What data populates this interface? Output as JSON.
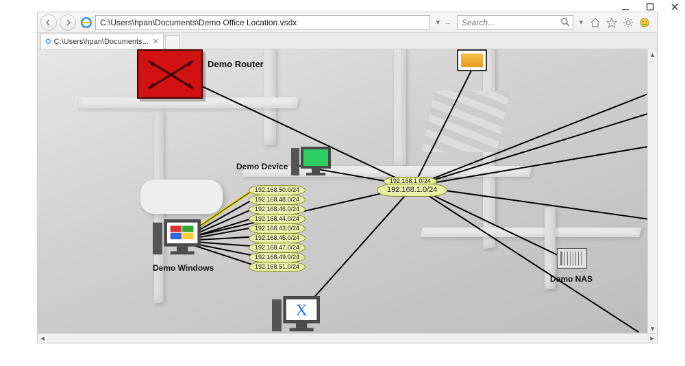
{
  "window": {
    "minimize": "–",
    "maximize": "☐",
    "close": "✕"
  },
  "browser": {
    "address_value": "C:\\Users\\hpan\\Documents\\Demo Office Location.vsdx",
    "search_placeholder": "Search...",
    "tab_title": "C:\\Users\\hpan\\Documents..."
  },
  "diagram": {
    "router_label": "Demo Router",
    "device_label": "Demo Device",
    "windows_label": "Demo Windows",
    "nas_label": "Demo NAS",
    "center_subnet_top": "192.168.1.0/24",
    "center_subnet_main": "192.168.1.0/24",
    "subnets": [
      "192.168.50.0/24",
      "192.168.48.0/24",
      "192.168.46.0/24",
      "192.168.44.0/24",
      "192.168.43.0/24",
      "192.168.45.0/24",
      "192.168.47.0/24",
      "192.168.49.0/24",
      "192.168.51.0/24"
    ]
  }
}
